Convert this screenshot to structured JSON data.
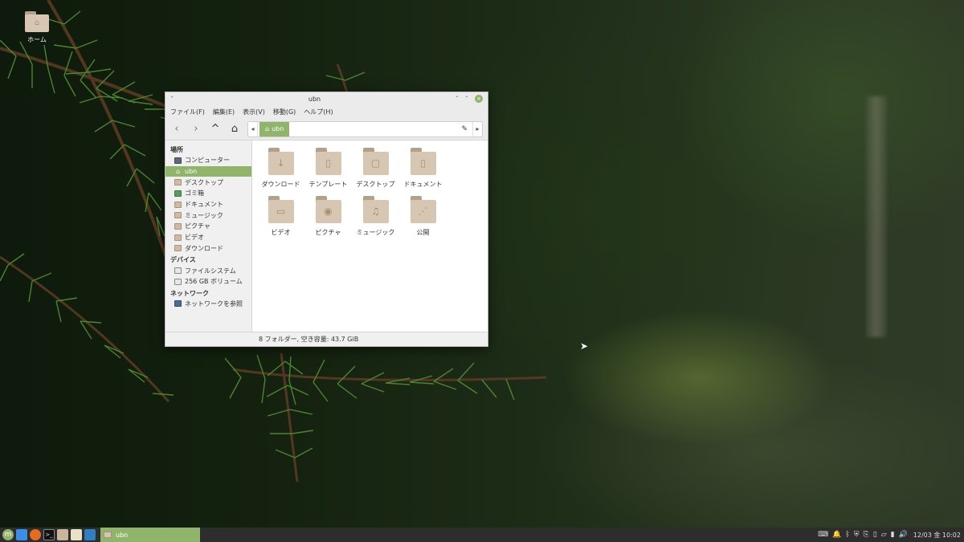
{
  "desktop": {
    "home_icon_label": "ホーム"
  },
  "window": {
    "title": "ubn",
    "title_controls": {
      "menu": "˅",
      "minimize": "ˇ",
      "maximize": "ˆ",
      "close": "×"
    },
    "menus": [
      "ファイル(F)",
      "編集(E)",
      "表示(V)",
      "移動(G)",
      "ヘルプ(H)"
    ],
    "toolbar": {
      "back": "‹",
      "forward": "›",
      "up": "^",
      "home": "⌂"
    },
    "path": {
      "prev": "◂",
      "crumb": "ubn",
      "next": "▸",
      "edit": "✎"
    },
    "sidebar": {
      "places_header": "場所",
      "places": [
        "コンピューター",
        "ubn",
        "デスクトップ",
        "ゴミ箱",
        "ドキュメント",
        "ミュージック",
        "ピクチャ",
        "ビデオ",
        "ダウンロード"
      ],
      "devices_header": "デバイス",
      "devices": [
        "ファイルシステム",
        "256 GB ボリューム"
      ],
      "network_header": "ネットワーク",
      "network": [
        "ネットワークを参照"
      ]
    },
    "files": [
      {
        "name": "ダウンロード",
        "icon": "↓"
      },
      {
        "name": "テンプレート",
        "icon": "▯"
      },
      {
        "name": "デスクトップ",
        "icon": "▢"
      },
      {
        "name": "ドキュメント",
        "icon": "▯"
      },
      {
        "name": "ビデオ",
        "icon": "▭"
      },
      {
        "name": "ピクチャ",
        "icon": "◉"
      },
      {
        "name": "ミュージック",
        "icon": "♫"
      },
      {
        "name": "公開",
        "icon": "⋰"
      }
    ],
    "status": "8 フォルダー, 空き容量: 43.7 GiB"
  },
  "taskbar": {
    "task_label": "ubn",
    "clock": "12/03 金 10:02"
  },
  "colors": {
    "accent": "#8fb46a",
    "taskbar": "#2d2d2d",
    "folder": "#d6c6b2"
  }
}
